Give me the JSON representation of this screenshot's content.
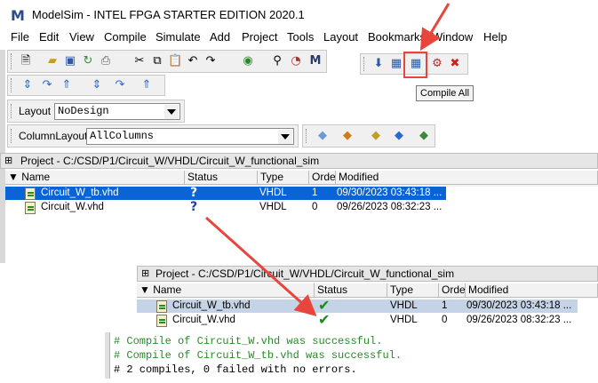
{
  "window": {
    "title": "ModelSim - INTEL FPGA STARTER EDITION 2020.1",
    "logo": "M"
  },
  "menu": [
    "File",
    "Edit",
    "View",
    "Compile",
    "Simulate",
    "Add",
    "Project",
    "Tools",
    "Layout",
    "Bookmarks",
    "Window",
    "Help"
  ],
  "toolbar": {
    "layout_label": "Layout",
    "layout_value": "NoDesign",
    "column_layout_label": "ColumnLayout",
    "column_layout_value": "AllColumns",
    "tooltip": "Compile All"
  },
  "project_top": {
    "title": "Project - C:/CSD/P1/Circuit_W/VHDL/Circuit_W_functional_sim",
    "columns": [
      "Name",
      "Status",
      "Type",
      "Order",
      "Modified"
    ],
    "rows": [
      {
        "name": "Circuit_W_tb.vhd",
        "status": "?",
        "type": "VHDL",
        "order": "1",
        "modified": "09/30/2023 03:43:18 ..."
      },
      {
        "name": "Circuit_W.vhd",
        "status": "?",
        "type": "VHDL",
        "order": "0",
        "modified": "09/26/2023 08:32:23 ..."
      }
    ]
  },
  "project_bottom": {
    "title": "Project - C:/CSD/P1/Circuit_W/VHDL/Circuit_W_functional_sim",
    "columns": [
      "Name",
      "Status",
      "Type",
      "Order",
      "Modified"
    ],
    "rows": [
      {
        "name": "Circuit_W_tb.vhd",
        "status": "✔",
        "type": "VHDL",
        "order": "1",
        "modified": "09/30/2023 03:43:18 ..."
      },
      {
        "name": "Circuit_W.vhd",
        "status": "✔",
        "type": "VHDL",
        "order": "0",
        "modified": "09/26/2023 08:32:23 ..."
      }
    ]
  },
  "transcript": [
    "# Compile of Circuit_W.vhd was successful.",
    "# Compile of Circuit_W_tb.vhd was successful.",
    "# 2 compiles, 0 failed with no errors."
  ],
  "colors": {
    "accent_red": "#e8453c",
    "selection": "#0a64d8",
    "success_text": "#2a8a2a"
  }
}
